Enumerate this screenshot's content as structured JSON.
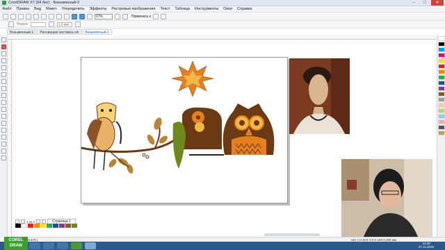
{
  "window": {
    "title": "CorelDRAW X7 (64 бит) - Безымянный-2",
    "controls": [
      "–",
      "□",
      "✕"
    ]
  },
  "menu": {
    "items": [
      "Файл",
      "Правка",
      "Вид",
      "Макет",
      "Упорядочить",
      "Эффекты",
      "Растровые изображения",
      "Текст",
      "Таблица",
      "Инструменты",
      "Окно",
      "Справка"
    ]
  },
  "toolbar": {
    "zoom_value": "67%",
    "snap_label": "Привязать к"
  },
  "propertybar": {
    "font_label": "Форма",
    "stroke_value": "1,0 мм"
  },
  "document_tabs": [
    "Безымянный-1",
    "Рисовашки-заставка.cdr",
    "Безымянный-2"
  ],
  "page_tabs": {
    "page_counter": "1 из 1",
    "page_label": "Страница 1"
  },
  "status": {
    "coords": "( 36,888 ; 175,473 )",
    "fill_info": "Нет",
    "color_info": "C:0 M:0 Y:0 K:100  0,200 мм"
  },
  "logo": {
    "line1": "COREL",
    "line2": "DRAW"
  },
  "clock": {
    "time": "12:40",
    "date": "27.11.2016"
  },
  "colors": {
    "brown": "#6b3a14",
    "orange": "#e6801e",
    "yellow_brown": "#b8863b",
    "olive": "#6e8a1e",
    "accent_blue": "#2a5db0"
  }
}
